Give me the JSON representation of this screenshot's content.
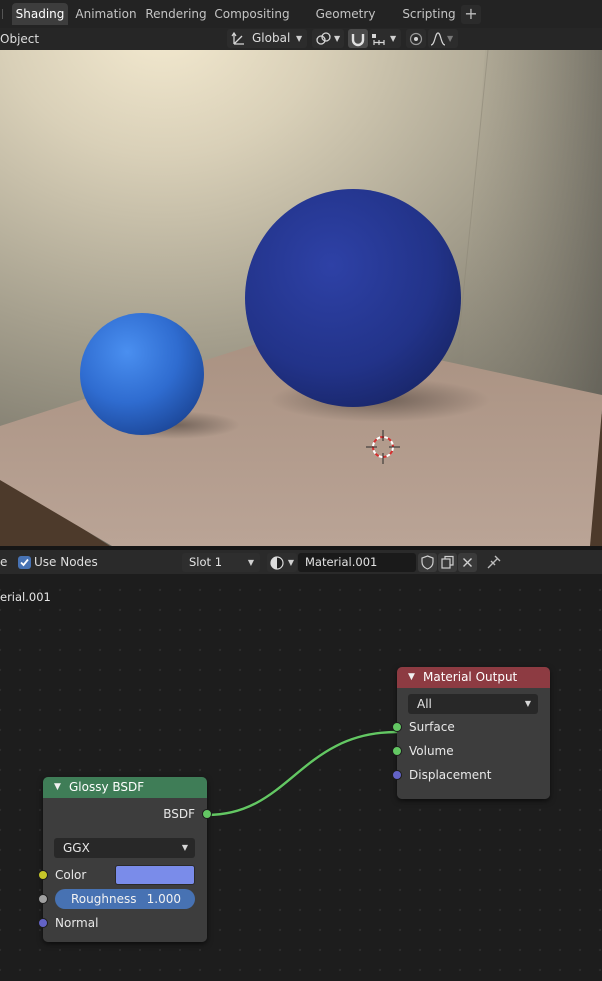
{
  "workspace_tabs": [
    {
      "label": "Shading",
      "active": true
    },
    {
      "label": "Animation",
      "active": false
    },
    {
      "label": "Rendering",
      "active": false
    },
    {
      "label": "Compositing",
      "active": false
    },
    {
      "label": "Geometry Nodes",
      "active": false
    },
    {
      "label": "Scripting",
      "active": false
    }
  ],
  "add_tab_label": "+",
  "viewport_header": {
    "mode_label": "Object",
    "transform_orientation": "Global"
  },
  "viewport": {
    "scene_objects": [
      "small-light-blue-sphere",
      "large-dark-blue-sphere",
      "table-plane",
      "3d-cursor"
    ]
  },
  "node_editor_header": {
    "cut_label": "e",
    "use_nodes_label": "Use Nodes",
    "use_nodes_checked": true,
    "slot_label": "Slot 1",
    "material_name": "Material.001"
  },
  "node_editor": {
    "material_breadcrumb": "erial.001",
    "nodes": {
      "glossy": {
        "title": "Glossy BSDF",
        "output_label": "BSDF",
        "distribution": "GGX",
        "color_label": "Color",
        "color_value": "#7a8cea",
        "roughness_label": "Roughness",
        "roughness_value": "1.000",
        "normal_label": "Normal",
        "header_color": "#3f7d57"
      },
      "output": {
        "title": "Material Output",
        "target": "All",
        "surface_label": "Surface",
        "volume_label": "Volume",
        "displacement_label": "Displacement",
        "header_color": "#8d3b42"
      }
    },
    "links": [
      {
        "from": "Glossy BSDF.BSDF",
        "to": "Material Output.Surface"
      }
    ]
  },
  "colors": {
    "accent_blue": "#4772b3",
    "socket_shader": "#63c763",
    "socket_color": "#c7c729",
    "socket_float": "#a1a1a1",
    "socket_vector": "#6363c7"
  }
}
